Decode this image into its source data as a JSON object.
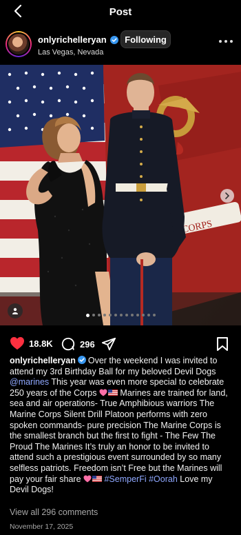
{
  "topbar": {
    "title": "Post",
    "back_icon": "chevron-left-icon"
  },
  "header": {
    "username": "onlyrichelleryan",
    "separator": "•",
    "follow_label": "Following",
    "location": "Las Vegas, Nevada",
    "more_icon": "more-horizontal-icon"
  },
  "media": {
    "carousel_total_dots": 13,
    "carousel_active_index": 0,
    "banner_text": "CORPS"
  },
  "actions": {
    "likes": "18.8K",
    "comments": "296",
    "like_icon": "heart-icon",
    "comment_icon": "comment-bubble-icon",
    "share_icon": "send-icon",
    "save_icon": "bookmark-icon"
  },
  "caption": {
    "username": "onlyrichelleryan",
    "text_1": "Over the weekend I was invited to attend my 3rd Birthday Ball for my beloved Devil Dogs ",
    "mention": "@marines",
    "text_2": " This year was even more special to celebrate 250 years of the Corps ",
    "text_3": " Marines are trained for land, sea and air operations- True Amphibious warriors The Marine Corps Silent Drill Platoon performs with zero spoken commands- pure precision The Marine Corps is the smallest branch but the first to fight - The Few The Proud The Marines It’s truly an honor to be invited to attend such a prestigious event surrounded by so many selfless patriots. Freedom isn’t Free but the Marines will pay your fair share ",
    "hashtag_1": "#SemperFi",
    "hashtag_2": "#Oorah",
    "text_4": " Love my Devil Dogs!"
  },
  "footer": {
    "view_comments": "View all 296 comments",
    "date": "November 17, 2025"
  },
  "colors": {
    "background": "#000000",
    "like_red": "#ff3040",
    "link_blue": "#8fa8ff",
    "verified_blue": "#3897f0",
    "muted_text": "#a8a8a8"
  }
}
